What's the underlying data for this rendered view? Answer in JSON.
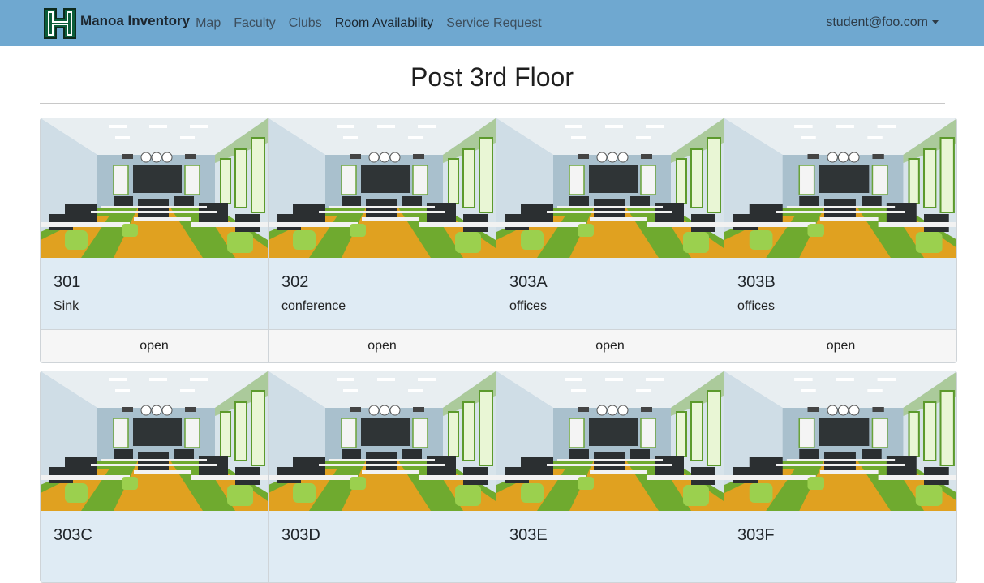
{
  "nav": {
    "brand": "Manoa Inventory",
    "links": [
      "Map",
      "Faculty",
      "Clubs",
      "Room Availability",
      "Service Request"
    ],
    "active": "Room Availability",
    "user": "student@foo.com",
    "logo_icon": "uh-h-logo-icon"
  },
  "page": {
    "title": "Post 3rd Floor"
  },
  "rooms": [
    {
      "number": "301",
      "type": "Sink",
      "status": "open"
    },
    {
      "number": "302",
      "type": "conference",
      "status": "open"
    },
    {
      "number": "303A",
      "type": "offices",
      "status": "open"
    },
    {
      "number": "303B",
      "type": "offices",
      "status": "open"
    },
    {
      "number": "303C",
      "type": "",
      "status": ""
    },
    {
      "number": "303D",
      "type": "",
      "status": ""
    },
    {
      "number": "303E",
      "type": "",
      "status": ""
    },
    {
      "number": "303F",
      "type": "",
      "status": ""
    }
  ],
  "colors": {
    "navbar": "#6fa8d0",
    "card_body": "#dfebf4",
    "card_footer": "#f6f6f6"
  }
}
